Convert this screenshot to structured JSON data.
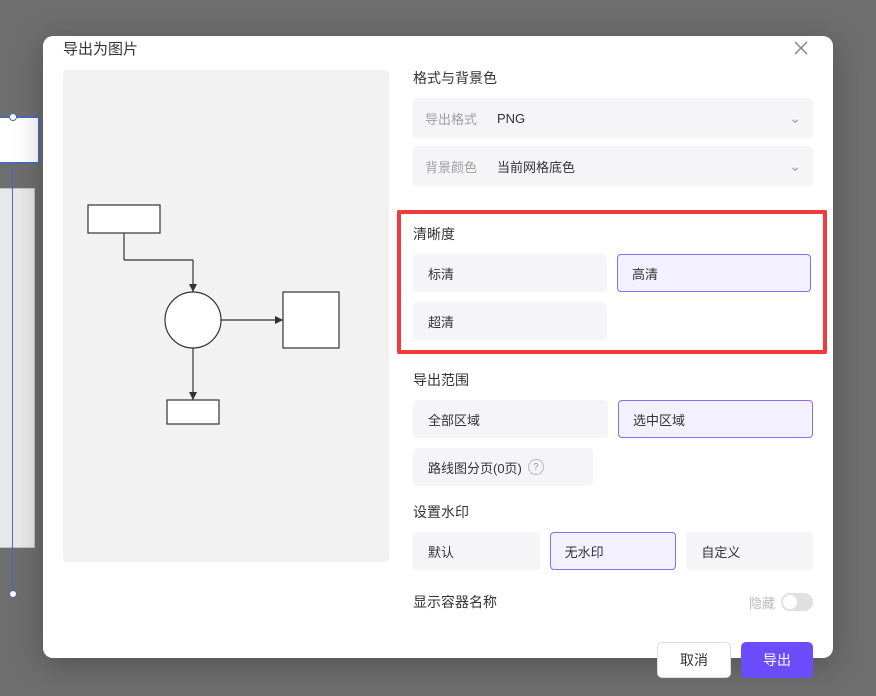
{
  "modal": {
    "title": "导出为图片"
  },
  "format_section": {
    "title": "格式与背景色",
    "format_label": "导出格式",
    "format_value": "PNG",
    "bg_label": "背景颜色",
    "bg_value": "当前网格底色"
  },
  "clarity_section": {
    "title": "清晰度",
    "options": [
      "标清",
      "高清",
      "超清"
    ],
    "selected_index": 1
  },
  "range_section": {
    "title": "导出范围",
    "all_label": "全部区域",
    "selected_label": "选中区域",
    "pagination_label": "路线图分页(0页)",
    "selected_index": 1
  },
  "watermark_section": {
    "title": "设置水印",
    "options": [
      "默认",
      "无水印",
      "自定义"
    ],
    "selected_index": 1
  },
  "container_section": {
    "label": "显示容器名称",
    "toggle_label": "隐藏"
  },
  "footer": {
    "cancel": "取消",
    "export": "导出"
  }
}
